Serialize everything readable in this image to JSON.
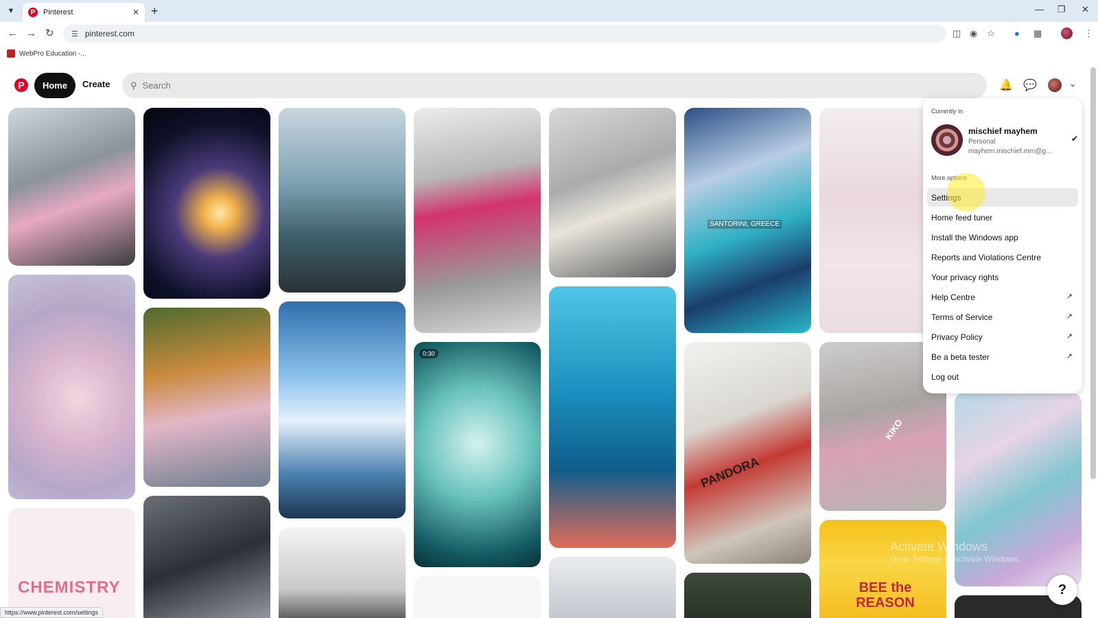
{
  "browser": {
    "tab_title": "Pinterest",
    "url": "pinterest.com",
    "bookmark_label": "WebPro Education -...",
    "status_url": "https://www.pinterest.com/settings"
  },
  "header": {
    "home_label": "Home",
    "create_label": "Create",
    "search_placeholder": "Search"
  },
  "pins": {
    "santorini_label": "SANTORINI, GREECE",
    "video_duration": "0:30",
    "chemistry_label": "CHEMISTRY",
    "pandora_label": "PANDORA",
    "kiko_label": "KIKO",
    "bee_label": "BEE the REASON"
  },
  "menu": {
    "currently_in": "Currently in",
    "account_name": "mischief mayhem",
    "account_type": "Personal",
    "account_email": "mayhem.mischief.mm@g...",
    "more_options": "More options",
    "items": [
      {
        "label": "Settings"
      },
      {
        "label": "Home feed tuner"
      },
      {
        "label": "Install the Windows app"
      },
      {
        "label": "Reports and Violations Centre"
      },
      {
        "label": "Your privacy rights"
      },
      {
        "label": "Help Centre"
      },
      {
        "label": "Terms of Service"
      },
      {
        "label": "Privacy Policy"
      },
      {
        "label": "Be a beta tester"
      },
      {
        "label": "Log out"
      }
    ]
  },
  "watermark": {
    "title": "Activate Windows",
    "subtitle": "Go to Settings to activate Windows."
  },
  "help_label": "?"
}
